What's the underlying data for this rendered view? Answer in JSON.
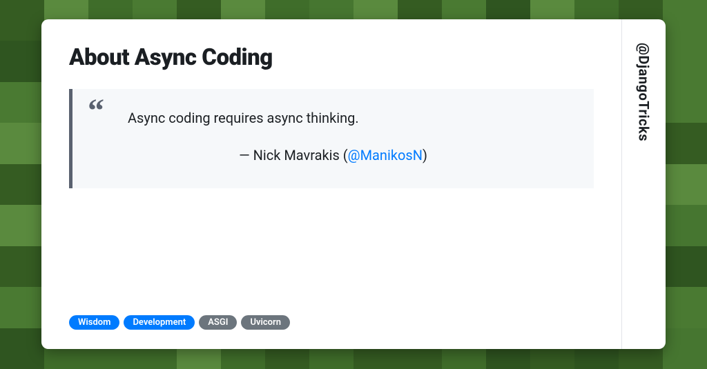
{
  "title": "About Async Coding",
  "quote": {
    "text": "Async coding requires async thinking.",
    "author_prefix": "— Nick Mavrakis (",
    "author_handle": "@ManikosN",
    "author_suffix": ")"
  },
  "tags": [
    {
      "label": "Wisdom",
      "variant": "blue"
    },
    {
      "label": "Development",
      "variant": "blue"
    },
    {
      "label": "ASGI",
      "variant": "gray"
    },
    {
      "label": "Uvicorn",
      "variant": "gray"
    }
  ],
  "sidebar_handle": "@DjangoTricks"
}
